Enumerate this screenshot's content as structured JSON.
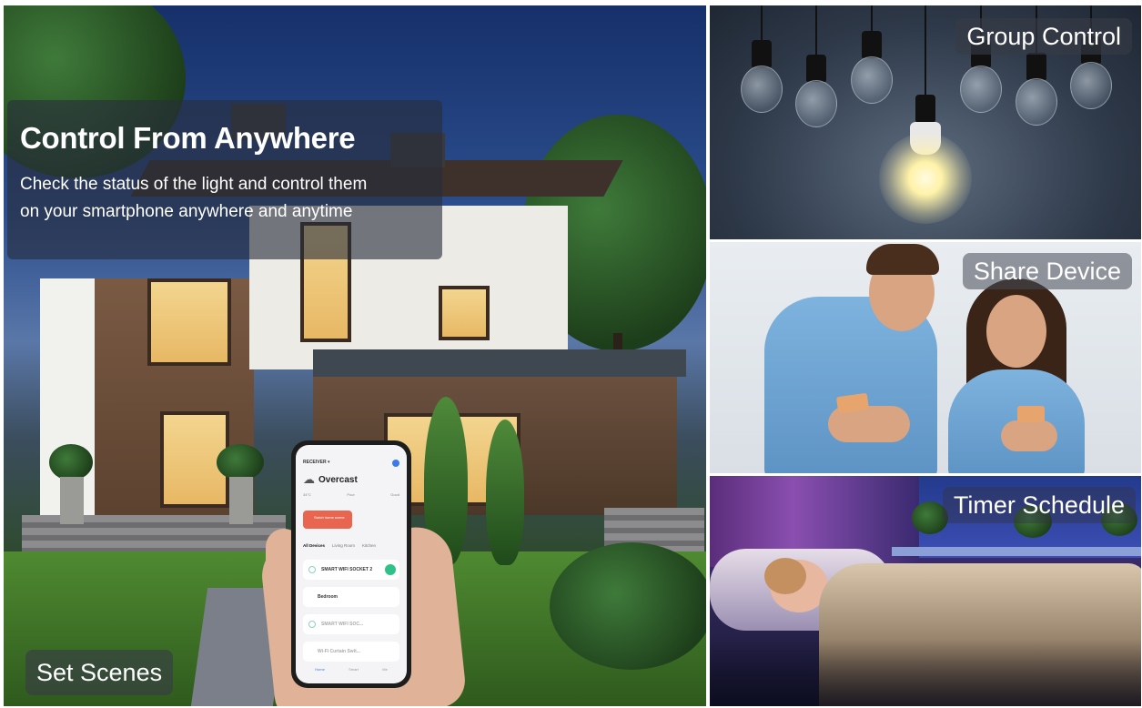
{
  "main_feature": {
    "title": "Control From Anywhere",
    "description_line1": "Check the status of the light and control them",
    "description_line2": "on your smartphone anywhere and anytime"
  },
  "labels": {
    "set_scenes": "Set Scenes",
    "group_control": "Group Control",
    "share_device": "Share Device",
    "timer_schedule": "Timer Schedule"
  },
  "phone_app": {
    "home_name": "RECEIVER ▾",
    "weather": "Overcast",
    "stats": [
      "34°C",
      "Poor",
      "Good"
    ],
    "scene_button": "Swich home scene",
    "tabs": [
      "All Devices",
      "Living Room",
      "Kitchen"
    ],
    "devices": [
      "SMART WIFI SOCKET 2",
      "Bedroom",
      "SMART WIFI SOC...",
      "Wi-Fi Curtain Swit..."
    ],
    "nav": [
      "Home",
      "Smart",
      "Me"
    ]
  },
  "colors": {
    "overlay": "#2b2f3c",
    "accent_scene": "#e8664f",
    "device_toggle": "#2ec28a"
  }
}
